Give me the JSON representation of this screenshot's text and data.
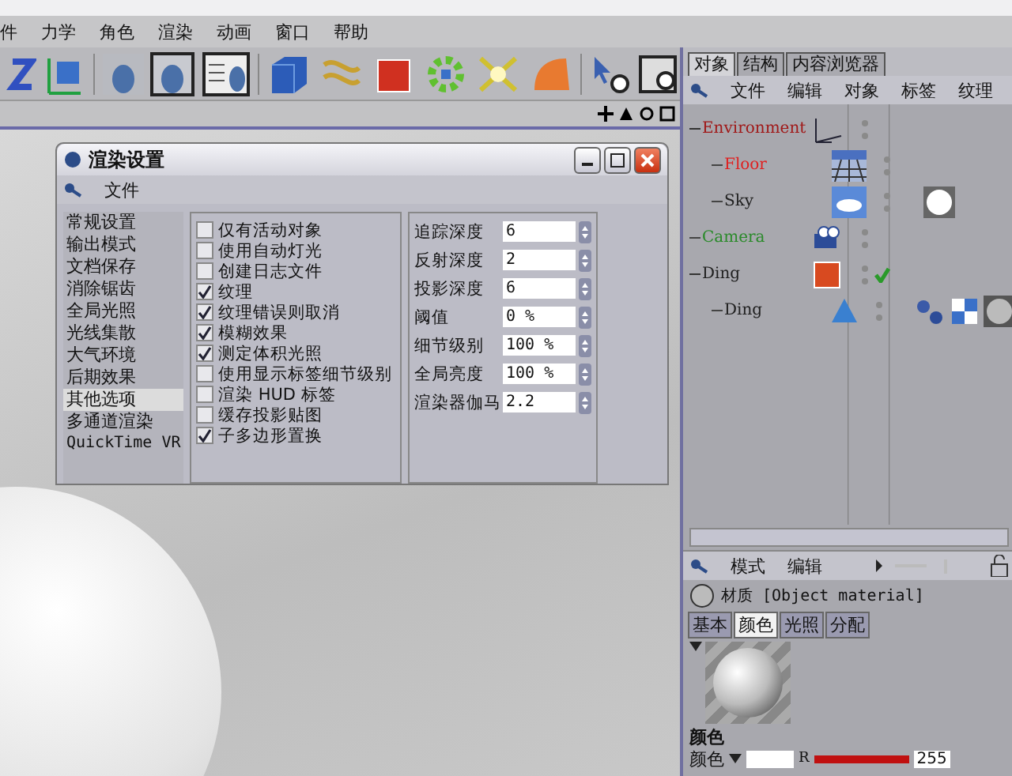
{
  "menu": [
    "件",
    "力学",
    "角色",
    "渲染",
    "动画",
    "窗口",
    "帮助"
  ],
  "dialog": {
    "title": "渲染设置",
    "menu": [
      "文件"
    ],
    "nav": [
      {
        "label": "常规设置",
        "selected": false
      },
      {
        "label": "输出模式",
        "selected": false
      },
      {
        "label": "文档保存",
        "selected": false
      },
      {
        "label": "消除锯齿",
        "selected": false
      },
      {
        "label": "全局光照",
        "selected": false
      },
      {
        "label": "光线集散",
        "selected": false
      },
      {
        "label": "大气环境",
        "selected": false
      },
      {
        "label": "后期效果",
        "selected": false
      },
      {
        "label": "其他选项",
        "selected": true
      },
      {
        "label": "多通道渲染",
        "selected": false
      },
      {
        "label": "QuickTime VR",
        "selected": false
      }
    ],
    "options": [
      {
        "label": "仅有活动对象",
        "checked": false
      },
      {
        "label": "使用自动灯光",
        "checked": false
      },
      {
        "label": "创建日志文件",
        "checked": false
      },
      {
        "label": "纹理",
        "checked": true
      },
      {
        "label": "纹理错误则取消",
        "checked": true
      },
      {
        "label": "模糊效果",
        "checked": true
      },
      {
        "label": "测定体积光照",
        "checked": true
      },
      {
        "label": "使用显示标签细节级别",
        "checked": false
      },
      {
        "label": "渲染 HUD 标签",
        "checked": false
      },
      {
        "label": "缓存投影贴图",
        "checked": false
      },
      {
        "label": "子多边形置换",
        "checked": true
      }
    ],
    "fields": [
      {
        "label": "追踪深度",
        "value": "6"
      },
      {
        "label": "反射深度",
        "value": "2"
      },
      {
        "label": "投影深度",
        "value": "6"
      },
      {
        "label": "阈值",
        "value": "0 %"
      },
      {
        "label": "细节级别",
        "value": "100 %"
      },
      {
        "label": "全局亮度",
        "value": "100 %"
      },
      {
        "label": "渲染器伽马",
        "value": "2.2"
      }
    ]
  },
  "objects": {
    "tabs": [
      {
        "label": "对象",
        "selected": true
      },
      {
        "label": "结构",
        "selected": false
      },
      {
        "label": "内容浏览器",
        "selected": false
      }
    ],
    "menu": [
      "文件",
      "编辑",
      "对象",
      "标签",
      "纹理"
    ],
    "tree": [
      {
        "name": "Environment",
        "color": "#a01818",
        "kind": "null",
        "checked": false,
        "children": [
          {
            "name": "Floor",
            "color": "#e02020",
            "kind": "floor",
            "checked": false
          },
          {
            "name": "Sky",
            "color": "#202020",
            "kind": "sky",
            "checked": false,
            "tags": [
              {
                "kind": "sphere"
              }
            ]
          }
        ]
      },
      {
        "name": "Camera",
        "color": "#2a8a2a",
        "kind": "camera",
        "checked": false
      },
      {
        "name": "Ding",
        "color": "#202020",
        "kind": "cube",
        "checked": true,
        "children": [
          {
            "name": "Ding",
            "color": "#202020",
            "kind": "cone",
            "checked": false,
            "tags": [
              {
                "kind": "phong"
              },
              {
                "kind": "texture"
              },
              {
                "kind": "material"
              }
            ]
          }
        ]
      }
    ]
  },
  "attributes": {
    "menu": [
      "模式",
      "编辑"
    ],
    "title": "材质 [Object material]",
    "tabs": [
      {
        "label": "基本",
        "selected": false
      },
      {
        "label": "颜色",
        "selected": true
      },
      {
        "label": "光照",
        "selected": false
      },
      {
        "label": "分配",
        "selected": false
      }
    ],
    "section": "颜色",
    "channel": {
      "label": "颜色",
      "component": "R",
      "level": 1.0,
      "value": "255"
    }
  }
}
